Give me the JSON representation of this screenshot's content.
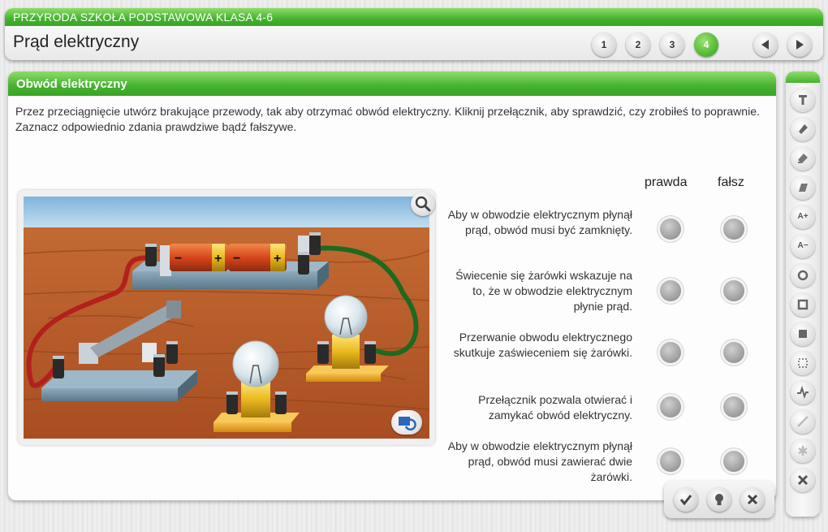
{
  "header": {
    "course": "PRZYRODA SZKOŁA PODSTAWOWA KLASA 4-6",
    "title": "Prąd elektryczny",
    "pages": [
      "1",
      "2",
      "3",
      "4"
    ],
    "active_page": "4"
  },
  "exercise": {
    "heading": "Obwód elektryczny",
    "instruction_line1": "Przez przeciągnięcie utwórz brakujące przewody, tak aby otrzymać obwód elektryczny. Kliknij przełącznik, aby sprawdzić, czy zrobiłeś to poprawnie.",
    "instruction_line2": "Zaznacz odpowiednio zdania prawdziwe bądź fałszywe.",
    "col_true": "prawda",
    "col_false": "fałsz",
    "statements": [
      "Aby w obwodzie elektrycznym płynął prąd, obwód musi być zamknięty.",
      "Świecenie się żarówki wskazuje na to, że w obwodzie elektrycznym płynie prąd.",
      "Przerwanie obwodu elektrycznego skutkuje zaświeceniem się żarówki.",
      "Przełącznik pozwala otwierać i zamykać obwód elektryczny.",
      "Aby w obwodzie elektrycznym płynął prąd, obwód musi zawierać dwie żarówki."
    ]
  },
  "scene": {
    "battery_minus": "−",
    "battery_plus": "+",
    "colors": {
      "red_wire": "#b3201d",
      "green_wire": "#1d6a1f",
      "floor": "#b45a2a",
      "sky": "#9ec9e6"
    }
  },
  "icons": {
    "prev": "triangle-left-icon",
    "next": "triangle-right-icon",
    "check": "check-icon",
    "hint": "bulb-icon",
    "close": "close-icon"
  },
  "toolbar": {
    "font_up": "A+",
    "font_down": "A−"
  },
  "theme": {
    "accent": "#45b22f"
  }
}
